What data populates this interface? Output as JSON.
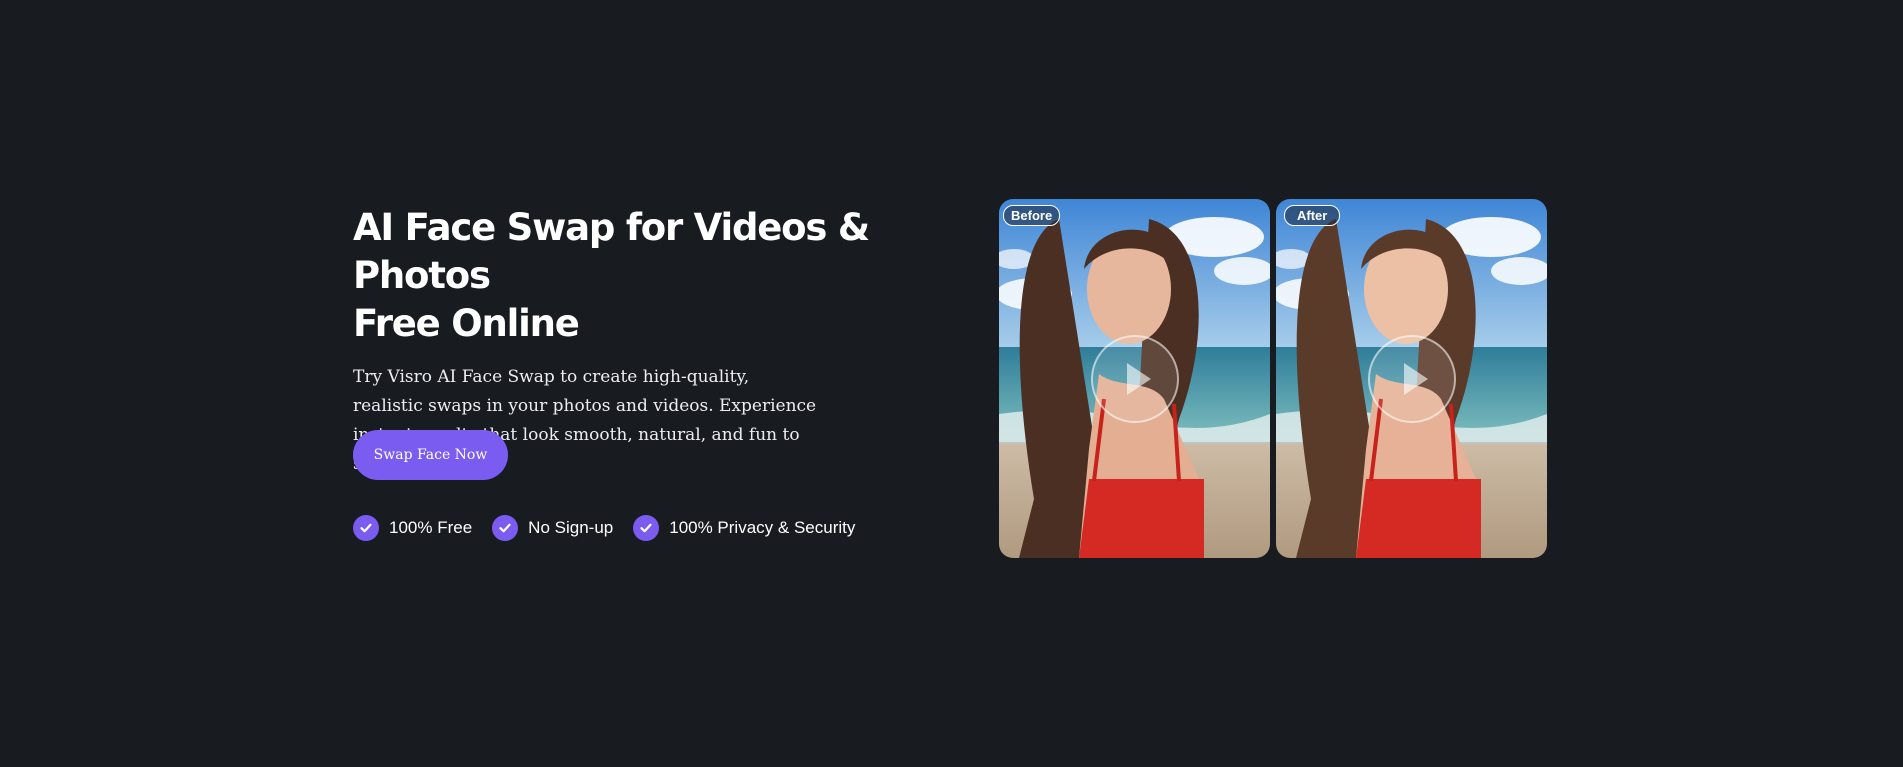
{
  "hero": {
    "title_line1": "AI Face Swap for Videos & Photos",
    "title_line2": "Free Online",
    "description": "Try Visro AI Face Swap to create high-quality, realistic swaps in your photos and videos. Experience instant results that look smooth, natural, and fun to share.",
    "cta_label": "Swap Face Now"
  },
  "features": [
    {
      "label": "100% Free",
      "icon": "check-icon"
    },
    {
      "label": "No Sign-up",
      "icon": "check-icon"
    },
    {
      "label": "100% Privacy & Security",
      "icon": "check-icon"
    }
  ],
  "comparison": {
    "before_label": "Before",
    "after_label": "After",
    "play_icon": "play-icon"
  },
  "colors": {
    "background": "#181b20",
    "accent": "#7b5cf0",
    "text": "#ffffff"
  }
}
